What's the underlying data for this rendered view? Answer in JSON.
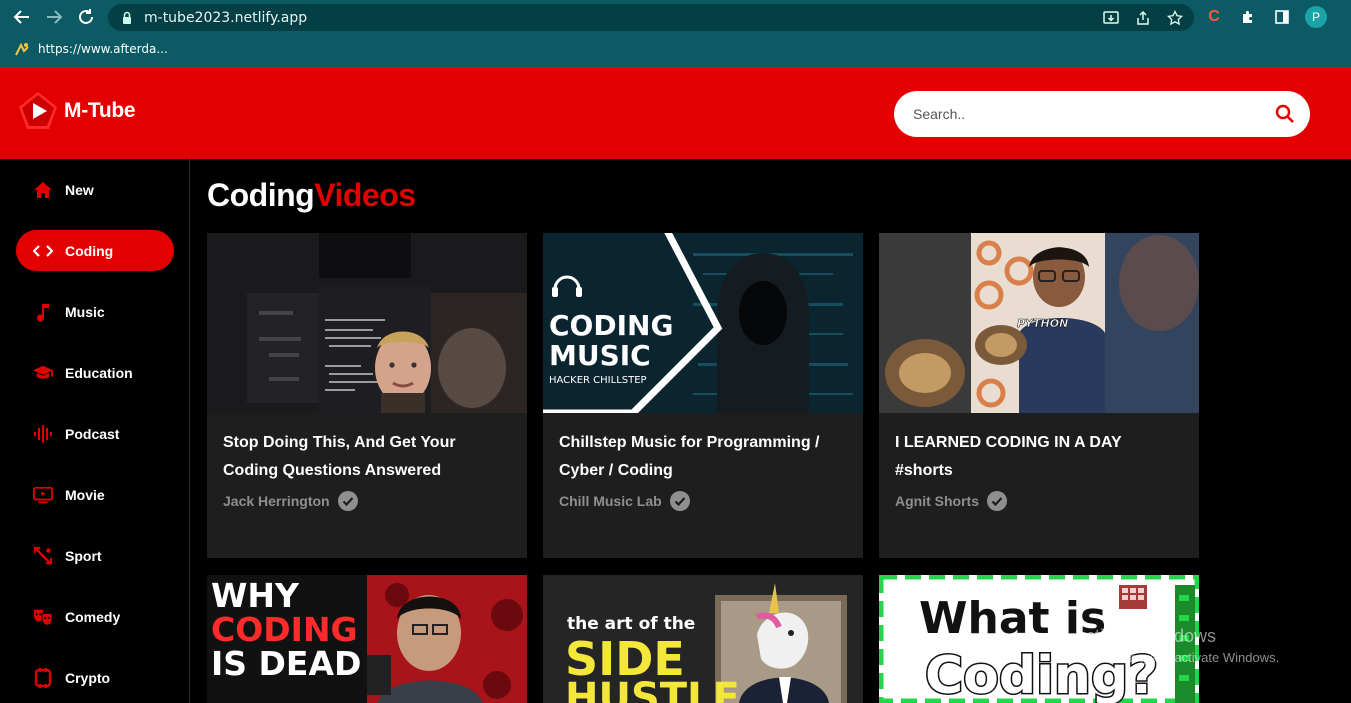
{
  "browser": {
    "url": "m-tube2023.netlify.app",
    "bookmark_label": "https://www.afterda...",
    "profile_initial": "P"
  },
  "app": {
    "brand": "M-Tube",
    "search_placeholder": "Search..",
    "accent_color": "#e30000"
  },
  "sidebar": {
    "items": [
      {
        "label": "New",
        "icon": "home-icon"
      },
      {
        "label": "Coding",
        "icon": "code-icon",
        "active": true
      },
      {
        "label": "Music",
        "icon": "music-note-icon"
      },
      {
        "label": "Education",
        "icon": "graduation-cap-icon"
      },
      {
        "label": "Podcast",
        "icon": "podcast-icon"
      },
      {
        "label": "Movie",
        "icon": "tv-icon"
      },
      {
        "label": "Sport",
        "icon": "sport-icon"
      },
      {
        "label": "Comedy",
        "icon": "masks-icon"
      },
      {
        "label": "Crypto",
        "icon": "crypto-icon"
      }
    ]
  },
  "main": {
    "title_prefix": "Coding",
    "title_accent": "Videos",
    "videos": [
      {
        "title": "Stop Doing This, And Get Your Coding Questions Answered",
        "channel": "Jack Herrington"
      },
      {
        "title": "Chillstep Music for Programming / Cyber / Coding",
        "channel": "Chill Music Lab",
        "thumb_text": {
          "line1": "CODING",
          "line2": "MUSIC",
          "line3": "HACKER CHILLSTEP"
        }
      },
      {
        "title": "I LEARNED CODING IN A DAY #shorts",
        "channel": "Agnit Shorts",
        "thumb_text": {
          "tag": "PYTHON"
        }
      },
      {
        "thumb_text": {
          "line1": "WHY",
          "line2": "CODING",
          "line3": "IS DEAD"
        }
      },
      {
        "thumb_text": {
          "line1": "the art of the",
          "line2": "SIDE",
          "line3": "HUSTLE"
        }
      },
      {
        "thumb_text": {
          "line1": "What is",
          "line2": "Coding?"
        }
      }
    ]
  },
  "watermark": {
    "line1": "Activate Windows",
    "line2": "Go to Settings to activate Windows."
  }
}
